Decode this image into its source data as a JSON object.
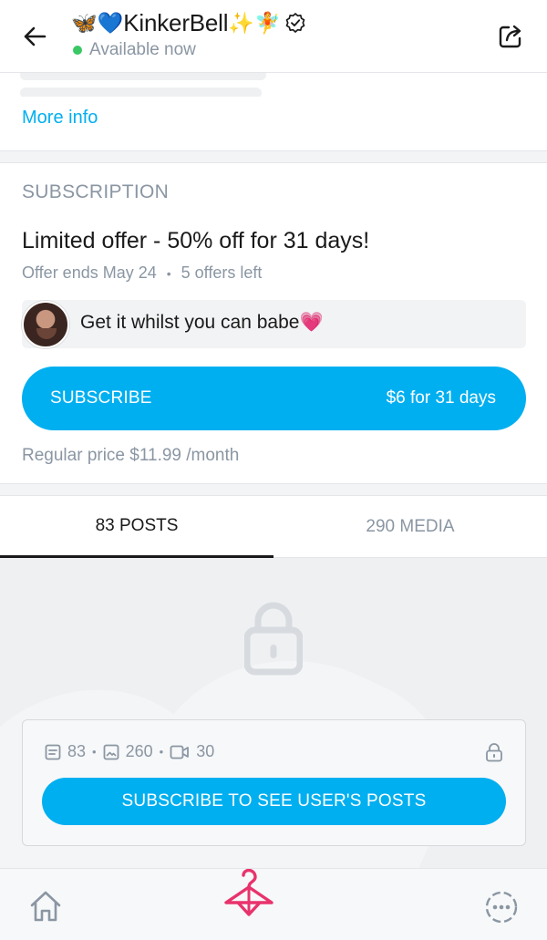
{
  "header": {
    "leading_emoji": "🦋💙",
    "name": "KinkerBell",
    "trailing_emoji": "✨🧚",
    "status": "Available now",
    "verified_icon": "verified-badge-icon",
    "back_icon": "arrow-left-icon",
    "share_icon": "share-icon"
  },
  "about": {
    "more_info": "More info"
  },
  "subscription": {
    "heading": "SUBSCRIPTION",
    "offer_title": "Limited offer - 50% off for 31 days!",
    "offer_ends": "Offer ends May 24",
    "offers_left": "5 offers left",
    "message": "Get it whilst you can babe",
    "message_emoji": "💗",
    "subscribe_label": "SUBSCRIBE",
    "subscribe_price": "$6 for 31 days",
    "regular_price": "Regular price $11.99 /month"
  },
  "tabs": [
    {
      "label": "83 POSTS",
      "active": true
    },
    {
      "label": "290 MEDIA",
      "active": false
    }
  ],
  "locked": {
    "posts_count": "83",
    "photos_count": "260",
    "videos_count": "30",
    "cta": "SUBSCRIBE TO SEE USER'S POSTS"
  },
  "bottom_nav": {
    "items": [
      "home-icon",
      "hanger-icon",
      "more-dots-icon"
    ]
  },
  "colors": {
    "accent": "#00aff0",
    "muted": "#8a96a3",
    "online": "#3ac864",
    "hanger": "#e8336d"
  }
}
